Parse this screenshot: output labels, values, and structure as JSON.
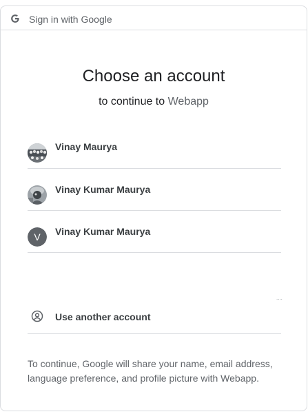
{
  "header": {
    "title": "Sign in with Google",
    "logo_icon": "google-g-icon"
  },
  "main": {
    "heading": "Choose an account",
    "subheading_prefix": "to continue to",
    "app_name": "Webapp"
  },
  "accounts": [
    {
      "name": "Vinay Maurya",
      "avatar": "photo"
    },
    {
      "name": "Vinay Kumar Maurya",
      "avatar": "photo"
    },
    {
      "name": "Vinay Kumar Maurya",
      "avatar": "initial",
      "initial": "V"
    }
  ],
  "use_another": {
    "label": "Use another account",
    "icon": "account-circle-icon"
  },
  "footer": {
    "text": "To continue, Google will share your name, email address, language preference, and profile picture with Webapp."
  },
  "colors": {
    "border": "#dadce0",
    "text_primary": "#202124",
    "text_secondary": "#5f6368",
    "initial_avatar_bg": "#5f6368"
  }
}
